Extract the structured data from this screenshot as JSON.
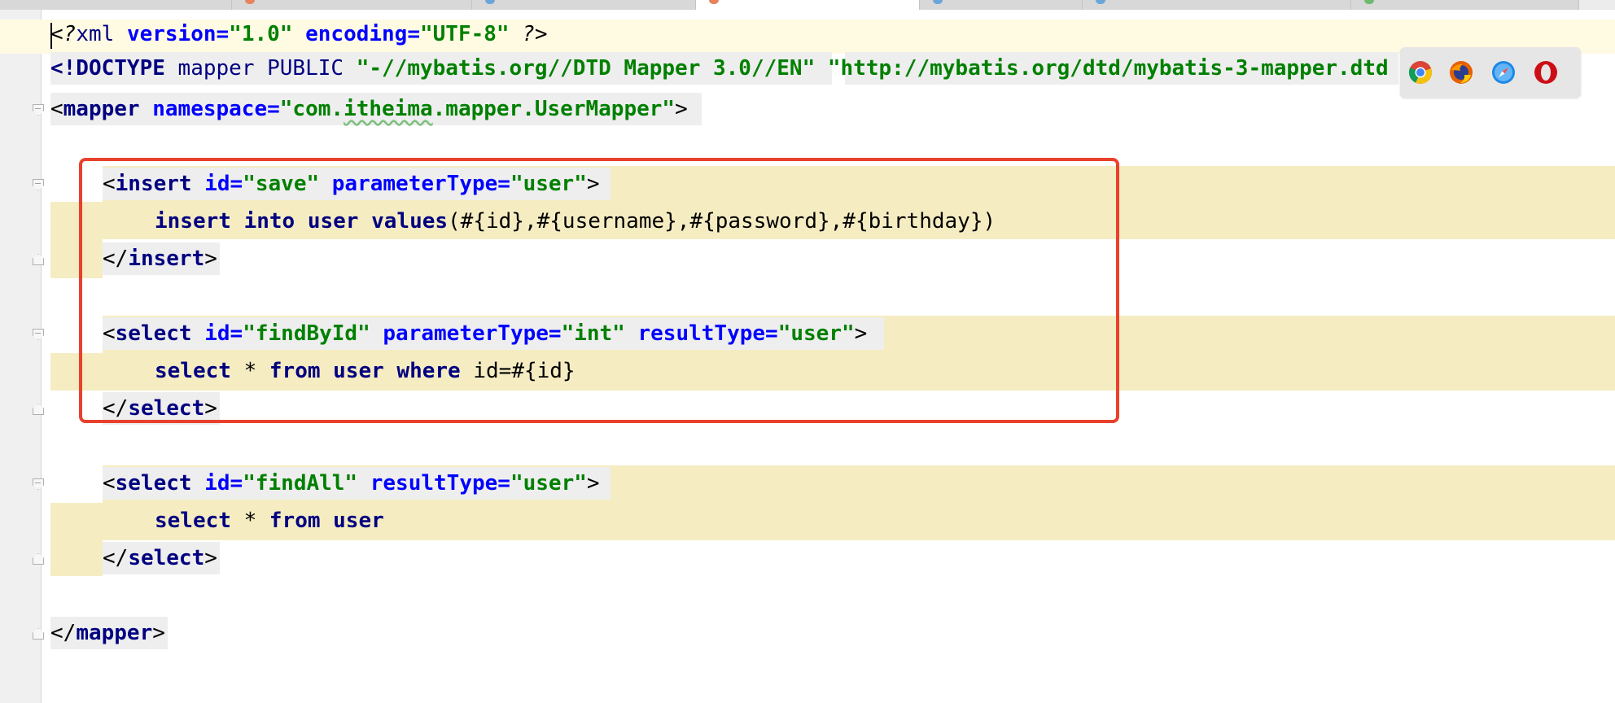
{
  "editor": {
    "lines": {
      "xml_decl": {
        "open": "<?",
        "tag": "xml",
        "attr1": "version",
        "eq1": "=",
        "val1": "\"1.0\"",
        "attr2": "encoding",
        "eq2": "=",
        "val2": "\"UTF-8\"",
        "close": "?>"
      },
      "doctype": {
        "open": "<!DOCTYPE",
        "name": "mapper",
        "public": "PUBLIC",
        "pubid": "\"-//mybatis.org//DTD Mapper 3.0//EN\"",
        "sysid_visible": "\"http://mybatis.org/dtd/mybatis-3-mapper.dtd"
      },
      "mapper_open": {
        "lt": "<",
        "tag": "mapper",
        "attr": "namespace",
        "eq": "=",
        "q1": "\"com.",
        "squiggle": "itheima",
        "q2": ".mapper.UserMapper\"",
        "gt": ">"
      },
      "insert_open": {
        "lt": "<",
        "tag": "insert",
        "attr1": "id",
        "eq1": "=",
        "val1": "\"save\"",
        "attr2": "parameterType",
        "eq2": "=",
        "val2": "\"user\"",
        "gt": ">"
      },
      "insert_body": {
        "kw1": "insert into user values",
        "rest": "(#{id},#{username},#{password},#{birthday})"
      },
      "insert_close": {
        "lt": "</",
        "tag": "insert",
        "gt": ">"
      },
      "select1_open": {
        "lt": "<",
        "tag": "select",
        "attr1": "id",
        "eq1": "=",
        "val1": "\"findById\"",
        "attr2": "parameterType",
        "eq2": "=",
        "val2": "\"int\"",
        "attr3": "resultType",
        "eq3": "=",
        "val3": "\"user\"",
        "gt": ">"
      },
      "select1_body": {
        "kw1": "select",
        "star": " * ",
        "kw2": "from user where",
        "rest": " id=#{id}"
      },
      "select1_close": {
        "lt": "</",
        "tag": "select",
        "gt": ">"
      },
      "select2_open": {
        "lt": "<",
        "tag": "select",
        "attr1": "id",
        "eq1": "=",
        "val1": "\"findAll\"",
        "attr2": "resultType",
        "eq2": "=",
        "val2": "\"user\"",
        "gt": ">"
      },
      "select2_body": {
        "kw1": "select",
        "star": " * ",
        "kw2": "from user"
      },
      "select2_close": {
        "lt": "</",
        "tag": "select",
        "gt": ">"
      },
      "mapper_close": {
        "lt": "</",
        "tag": "mapper",
        "gt": ">"
      }
    }
  },
  "browser_icons": [
    "chrome-icon",
    "firefox-icon",
    "safari-icon",
    "opera-icon"
  ],
  "colors": {
    "tag": "#000080",
    "attribute": "#0000ff",
    "string": "#008000",
    "highlight": "#f5ecc2",
    "annotation_box": "#e8412c"
  }
}
